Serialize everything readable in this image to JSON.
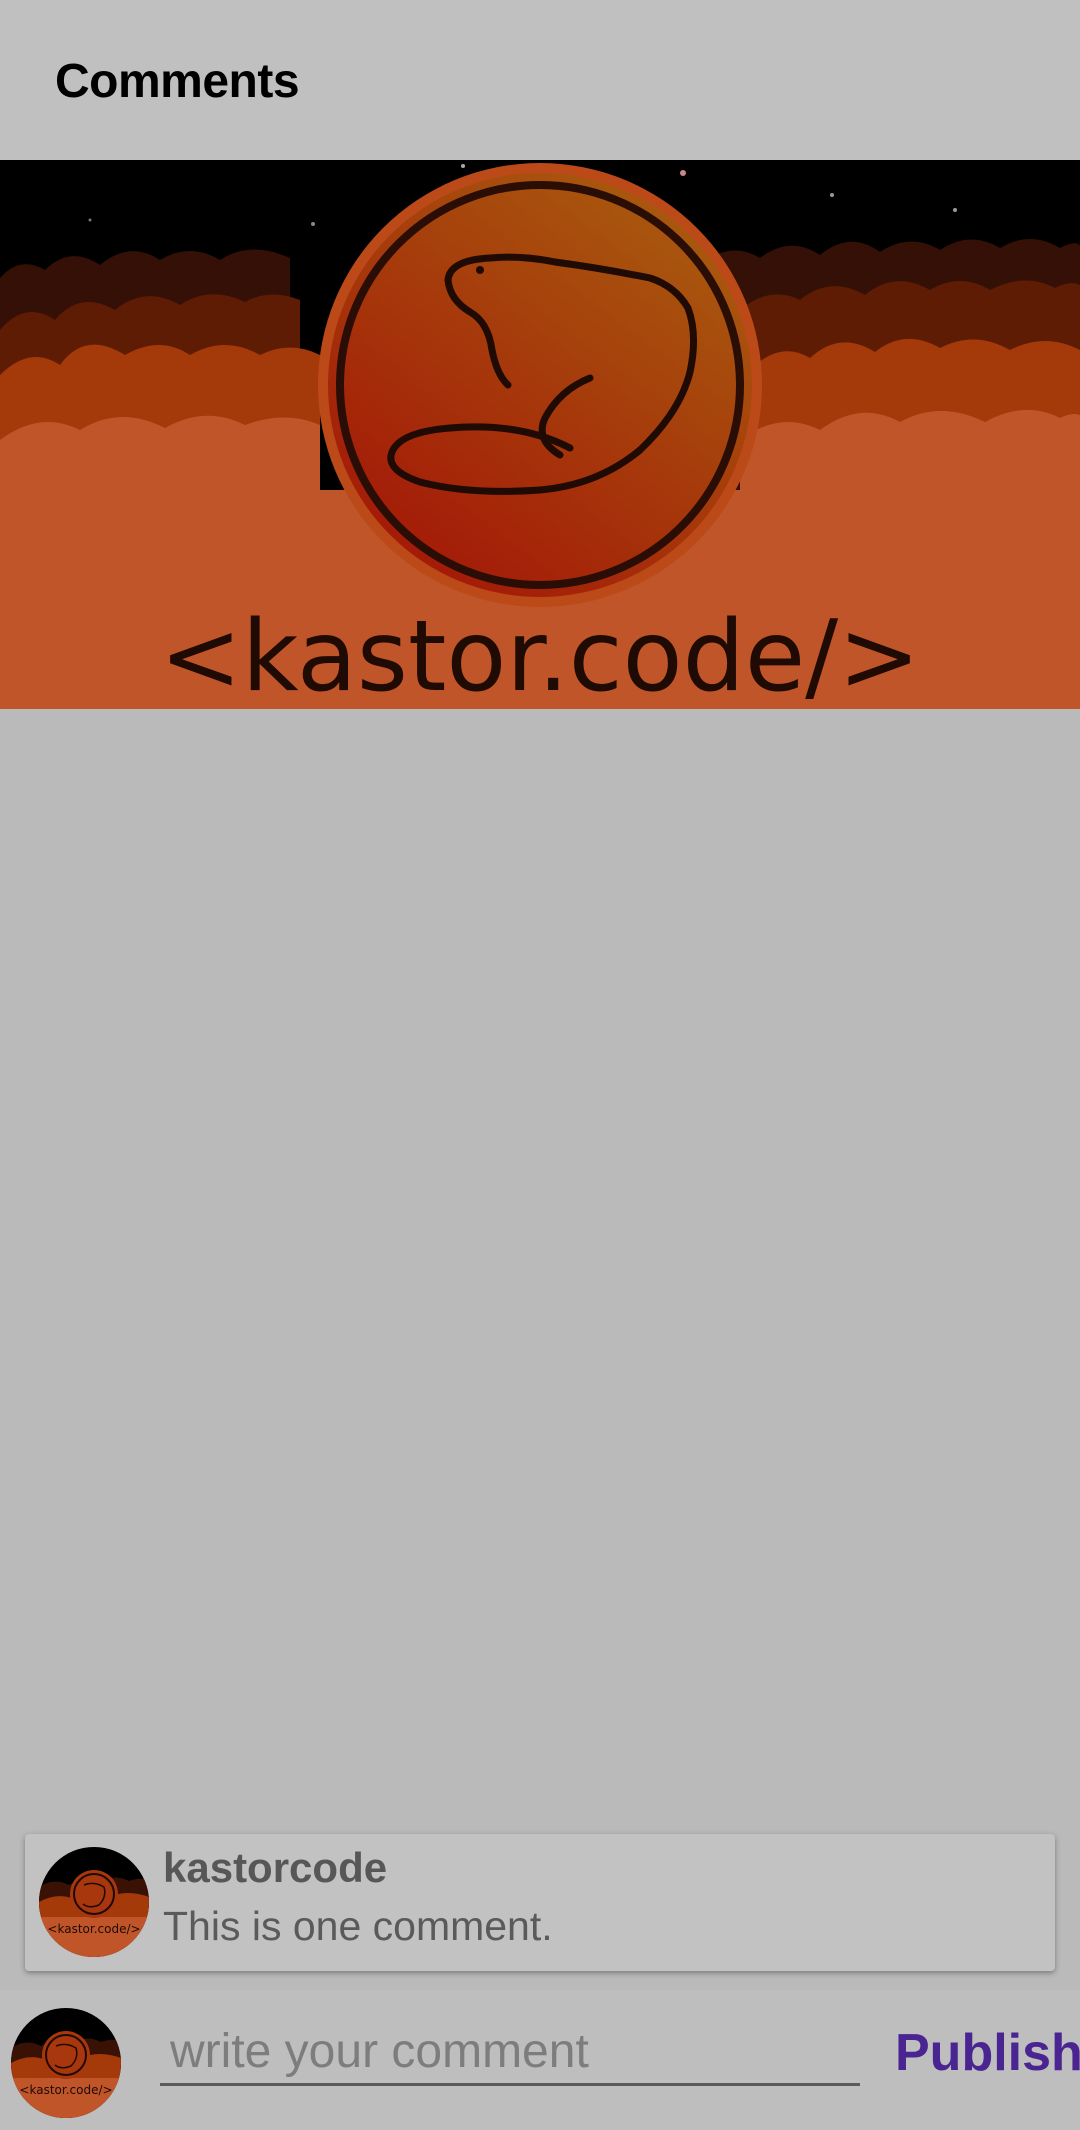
{
  "app_bar": {
    "title": "Comments"
  },
  "banner": {
    "logo_text": "<kastor.code/>",
    "logo_icon": "beaver-icon"
  },
  "comments": [
    {
      "author": "kastorcode",
      "text": "This is one comment.",
      "avatar_text": "<kastor.code/>"
    }
  ],
  "composer": {
    "placeholder": "write your comment",
    "value": "",
    "publish_label": "Publish",
    "avatar_text": "<kastor.code/>"
  },
  "colors": {
    "background_dim": "#bababa",
    "accent": "#4a2592",
    "banner_sky": "#000000",
    "banner_orange": "#c0552a"
  }
}
